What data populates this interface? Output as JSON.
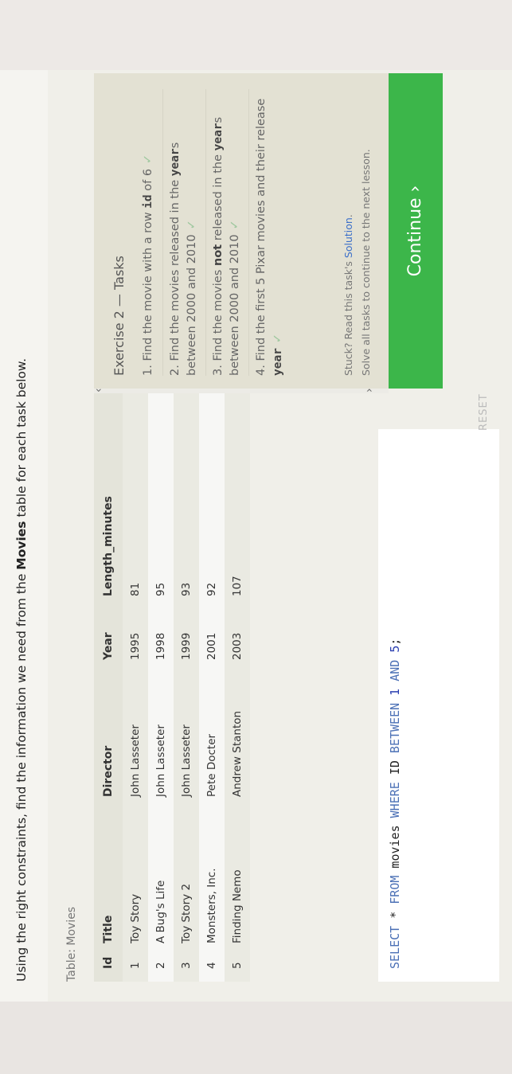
{
  "instruction": {
    "before": "Using the right constraints, find the information we need from the ",
    "bold": "Movies",
    "after": " table for each task below."
  },
  "table": {
    "caption": "Table: Movies",
    "columns": [
      "Id",
      "Title",
      "Director",
      "Year",
      "Length_minutes"
    ],
    "rows": [
      [
        "1",
        "Toy Story",
        "John Lasseter",
        "1995",
        "81"
      ],
      [
        "2",
        "A Bug's Life",
        "John Lasseter",
        "1998",
        "95"
      ],
      [
        "3",
        "Toy Story 2",
        "John Lasseter",
        "1999",
        "93"
      ],
      [
        "4",
        "Monsters, Inc.",
        "Pete Docter",
        "2001",
        "92"
      ],
      [
        "5",
        "Finding Nemo",
        "Andrew Stanton",
        "2003",
        "107"
      ]
    ]
  },
  "editor": {
    "sql": {
      "select": "SELECT",
      "star": " * ",
      "from": "FROM",
      "table": " movies ",
      "where": "WHERE",
      "col": " ID ",
      "between": "BETWEEN",
      "low": "1",
      "and": "AND",
      "high": "5",
      "end": ";"
    },
    "reset_label": "RESET"
  },
  "tasks": {
    "title": "Exercise 2 — Tasks",
    "items": [
      {
        "num": "1.",
        "text_a": "Find the movie with a row ",
        "code": "id",
        "text_b": " of 6"
      },
      {
        "num": "2.",
        "text_a": "Find the movies released in the ",
        "code": "year",
        "text_b": "s between 2000 and 2010"
      },
      {
        "num": "3.",
        "text_a": "Find the movies ",
        "bold": "not",
        "text_b": " released in the ",
        "code": "year",
        "text_c": "s between 2000 and 2010"
      },
      {
        "num": "4.",
        "text_a": "Find the first 5 Pixar movies and their release ",
        "code": "year"
      }
    ],
    "check": "✓",
    "stuck_a": "Stuck? Read this task's ",
    "stuck_link": "Solution",
    "stuck_b": ".",
    "solve_all": "Solve all tasks to continue to the next lesson."
  },
  "continue_label": "Continue ›",
  "scroll": {
    "left": "‹",
    "right": "›"
  },
  "colors": {
    "accent": "#3cb64a",
    "link": "#3b6fc9",
    "keyword": "#4a6fb5"
  }
}
